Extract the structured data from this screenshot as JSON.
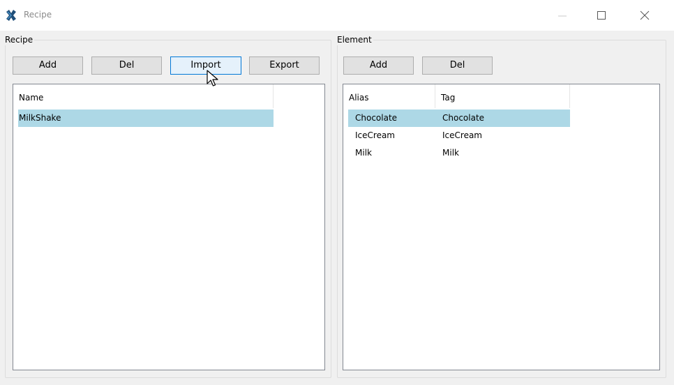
{
  "window": {
    "title": "Recipe",
    "app_icon": "tool-x-icon",
    "controls": [
      "minimize-icon",
      "maximize-icon",
      "close-icon"
    ]
  },
  "recipe_group": {
    "title": "Recipe",
    "buttons": {
      "add": "Add",
      "del": "Del",
      "import": "Import",
      "export": "Export"
    },
    "list": {
      "columns": [
        "Name"
      ],
      "rows": [
        {
          "name": "MilkShake",
          "selected": true
        }
      ]
    }
  },
  "element_group": {
    "title": "Element",
    "buttons": {
      "add": "Add",
      "del": "Del"
    },
    "list": {
      "columns": [
        "Alias",
        "Tag"
      ],
      "rows": [
        {
          "alias": "Chocolate",
          "tag": "Chocolate",
          "selected": true
        },
        {
          "alias": "IceCream",
          "tag": "IceCream",
          "selected": false
        },
        {
          "alias": "Milk",
          "tag": "Milk",
          "selected": false
        }
      ]
    }
  },
  "colors": {
    "selection": "#add8e6",
    "hover_button_border": "#0078d7",
    "hover_button_bg": "#e5f1fb",
    "window_bg": "#f0f0f0"
  },
  "pointer": {
    "icon": "mouse-pointer-icon",
    "hovering": "import-button"
  }
}
